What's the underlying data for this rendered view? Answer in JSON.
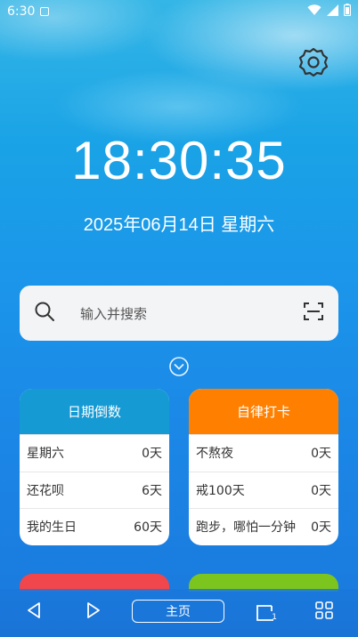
{
  "status_bar": {
    "time": "6:30",
    "icons": [
      "app-notification-icon",
      "wifi-icon",
      "signal-icon",
      "battery-icon"
    ]
  },
  "settings_icon": "gear-icon",
  "clock": {
    "time": "18:30:35"
  },
  "date": {
    "text": "2025年06月14日 星期六"
  },
  "search": {
    "placeholder": "输入并搜索",
    "left_icon": "search-icon",
    "right_icon": "scan-icon"
  },
  "expand_icon": "chevron-down-circle-icon",
  "cards": [
    {
      "title": "日期倒数",
      "color": "#159ad4",
      "rows": [
        {
          "label": "星期六",
          "value": "0天"
        },
        {
          "label": "还花呗",
          "value": "6天"
        },
        {
          "label": "我的生日",
          "value": "60天"
        }
      ]
    },
    {
      "title": "自律打卡",
      "color": "#ff8000",
      "rows": [
        {
          "label": "不熬夜",
          "value": "0天"
        },
        {
          "label": "戒100天",
          "value": "0天"
        },
        {
          "label": "跑步，哪怕一分钟",
          "value": "0天"
        }
      ]
    }
  ],
  "peek_colors": [
    "#f0464c",
    "#7cc41e"
  ],
  "nav": {
    "home_label": "主页",
    "tab_count": "1",
    "icons": [
      "back-icon",
      "forward-icon",
      "tabs-icon",
      "grid-menu-icon"
    ]
  }
}
